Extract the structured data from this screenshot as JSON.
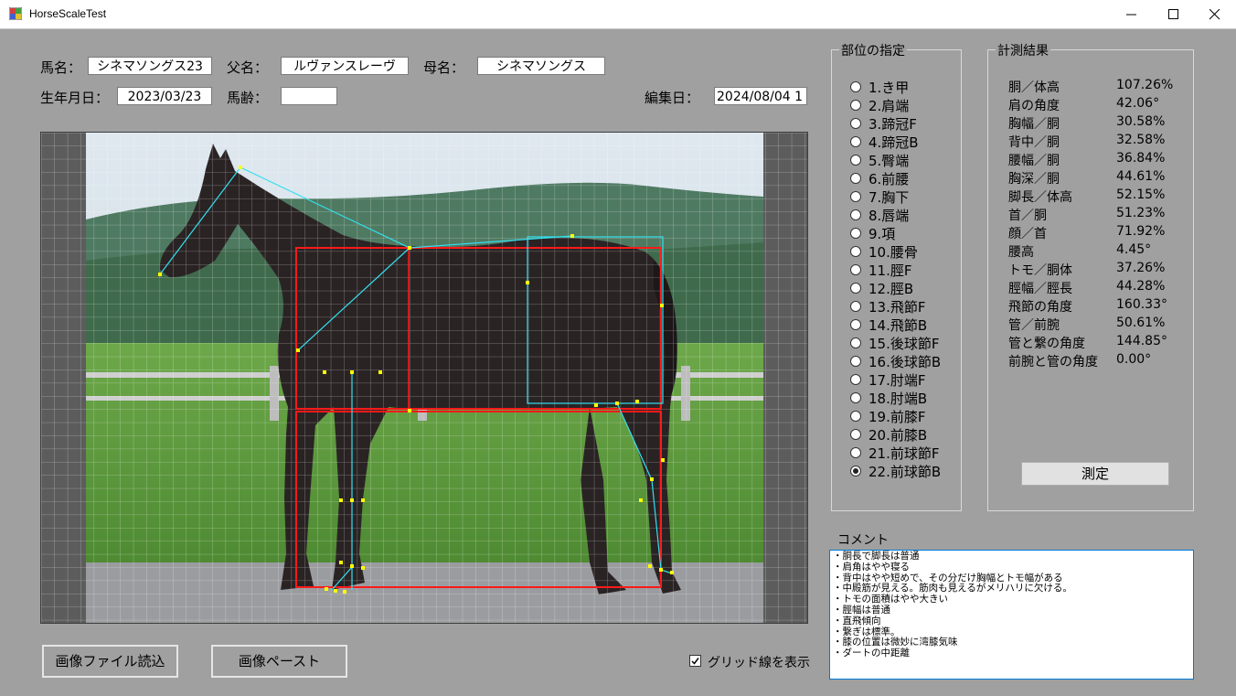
{
  "window": {
    "title": "HorseScaleTest"
  },
  "header": {
    "horse_name_label": "馬名：",
    "horse_name": "シネマソングス23",
    "sire_label": "父名：",
    "sire": "ルヴァンスレーヴ",
    "dam_label": "母名：",
    "dam": "シネマソングス",
    "birthdate_label": "生年月日：",
    "birthdate": "2023/03/23",
    "age_label": "馬齢：",
    "age": "",
    "edit_date_label": "編集日：",
    "edit_date": "2024/08/04 1"
  },
  "parts": {
    "title": "部位の指定",
    "items": [
      "1.き甲",
      "2.肩端",
      "3.蹄冠F",
      "4.蹄冠B",
      "5.臀端",
      "6.前腰",
      "7.胸下",
      "8.唇端",
      "9.項",
      "10.腰骨",
      "11.脛F",
      "12.脛B",
      "13.飛節F",
      "14.飛節B",
      "15.後球節F",
      "16.後球節B",
      "17.肘端F",
      "18.肘端B",
      "19.前膝F",
      "20.前膝B",
      "21.前球節F",
      "22.前球節B"
    ],
    "selected_index": 21
  },
  "results": {
    "title": "計測結果",
    "rows": [
      {
        "name": "胴／体高",
        "value": "107.26%"
      },
      {
        "name": "肩の角度",
        "value": "42.06°"
      },
      {
        "name": "胸幅／胴",
        "value": "30.58%"
      },
      {
        "name": "背中／胴",
        "value": "32.58%"
      },
      {
        "name": "腰幅／胴",
        "value": "36.84%"
      },
      {
        "name": "胸深／胴",
        "value": "44.61%"
      },
      {
        "name": "脚長／体高",
        "value": "52.15%"
      },
      {
        "name": "首／胴",
        "value": "51.23%"
      },
      {
        "name": "顔／首",
        "value": "71.92%"
      },
      {
        "name": "腰高",
        "value": "4.45°"
      },
      {
        "name": "トモ／胴体",
        "value": "37.26%"
      },
      {
        "name": "脛幅／脛長",
        "value": "44.28%"
      },
      {
        "name": "飛節の角度",
        "value": "160.33°"
      },
      {
        "name": "管／前腕",
        "value": "50.61%"
      },
      {
        "name": "管と繋の角度",
        "value": "144.85°"
      },
      {
        "name": "前腕と管の角度",
        "value": "0.00°"
      }
    ],
    "measure_button": "測定"
  },
  "comment": {
    "label": "コメント",
    "lines": [
      "・胴長で脚長は普通",
      "・肩角はやや寝る",
      "・背中はやや短めで、その分だけ胸幅とトモ幅がある",
      "・中殿筋が見える。筋肉も見えるがメリハリに欠ける。",
      "・トモの面積はやや大きい",
      "・脛幅は普通",
      "・直飛傾向",
      "・繋ぎは標準。",
      "・膝の位置は微妙に湾膝気味",
      "・ダートの中距離"
    ]
  },
  "footer": {
    "load_image_button": "画像ファイル読込",
    "paste_image_button": "画像ペースト",
    "grid_checkbox_label": "グリッド線を表示",
    "grid_checked": true
  },
  "colors": {
    "form_bg": "#a0a0a0",
    "overlay_rect": "#ff1a1a",
    "overlay_line": "#33e0f0",
    "overlay_point": "#ffff00",
    "focus_border": "#0078d7"
  }
}
